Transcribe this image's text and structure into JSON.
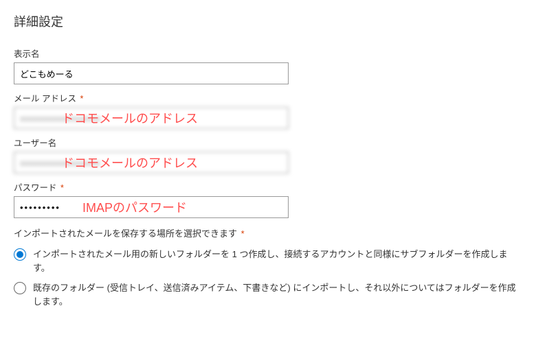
{
  "page": {
    "title": "詳細設定"
  },
  "fields": {
    "display_name": {
      "label": "表示名",
      "value": "どこもめーる",
      "required": false
    },
    "email": {
      "label": "メール アドレス",
      "value": "",
      "required": true,
      "annotation": "ドコモメールのアドレス"
    },
    "username": {
      "label": "ユーザー名",
      "value": "",
      "required": false,
      "annotation": "ドコモメールのアドレス"
    },
    "password": {
      "label": "パスワード",
      "value": "•••••••••",
      "required": true,
      "annotation": "IMAPのパスワード"
    }
  },
  "import_location": {
    "label": "インポートされたメールを保存する場所を選択できます",
    "required": true,
    "options": {
      "create_new": "インポートされたメール用の新しいフォルダーを 1 つ作成し、接続するアカウントと同様にサブフォルダーを作成します。",
      "use_existing": "既存のフォルダー (受信トレイ、送信済みアイテム、下書きなど) にインポートし、それ以外についてはフォルダーを作成します。"
    },
    "selected": "create_new"
  }
}
